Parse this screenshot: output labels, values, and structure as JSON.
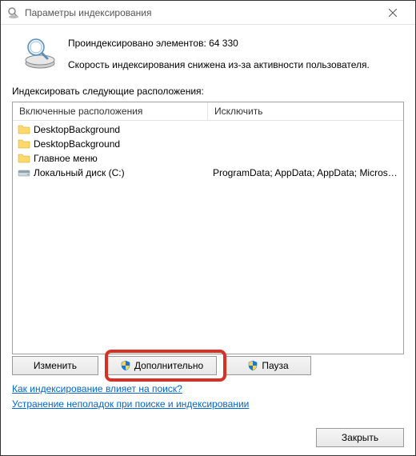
{
  "title": "Параметры индексирования",
  "header": {
    "indexed": "Проиндексировано элементов: 64 330",
    "speed": "Скорость индексирования снижена из-за активности пользователя."
  },
  "section_label": "Индексировать следующие расположения:",
  "columns": {
    "included": "Включенные расположения",
    "exclude": "Исключить"
  },
  "locations": [
    {
      "name": "DesktopBackground",
      "type": "folder",
      "exclude": ""
    },
    {
      "name": "DesktopBackground",
      "type": "folder",
      "exclude": ""
    },
    {
      "name": "Главное меню",
      "type": "folder",
      "exclude": ""
    },
    {
      "name": "Локальный диск (C:)",
      "type": "disk",
      "exclude": "ProgramData; AppData; AppData; Microso..."
    }
  ],
  "buttons": {
    "modify": "Изменить",
    "advanced": "Дополнительно",
    "pause": "Пауза",
    "close": "Закрыть"
  },
  "links": {
    "how": "Как индексирование влияет на поиск?",
    "troubleshoot": "Устранение неполадок при поиске и индексировании"
  }
}
